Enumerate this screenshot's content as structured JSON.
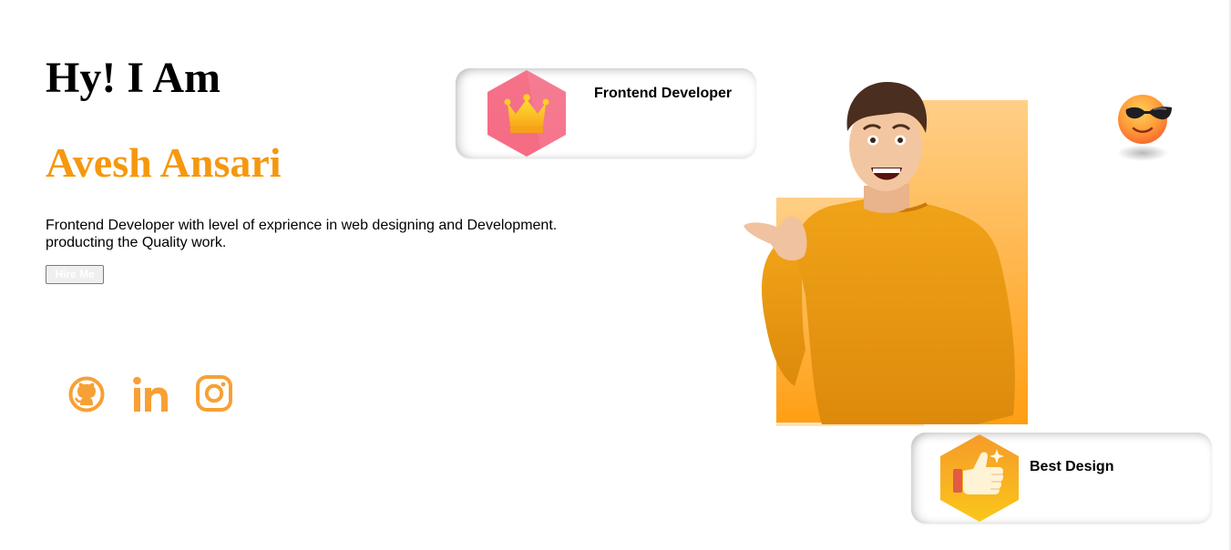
{
  "hero": {
    "greeting": "Hy! I Am",
    "name": "Avesh Ansari",
    "bio": "Frontend Developer with level of exprience in web designing and Development. producting the Quality work.",
    "hire_label": "Hire Me"
  },
  "socials": [
    {
      "icon": "github-icon"
    },
    {
      "icon": "linkedin-icon"
    },
    {
      "icon": "instagram-icon"
    }
  ],
  "badges": [
    {
      "label": "Frontend Developer",
      "icon": "crown-icon"
    },
    {
      "label": "Best Design",
      "icon": "thumbs-up-icon"
    }
  ],
  "decor": {
    "emoji": "sunglasses-emoji"
  },
  "colors": {
    "accent": "#f5980e",
    "social_icon": "#f7a035",
    "crown_hex": "#f56b84",
    "thumb_hex": "#f7b416"
  }
}
